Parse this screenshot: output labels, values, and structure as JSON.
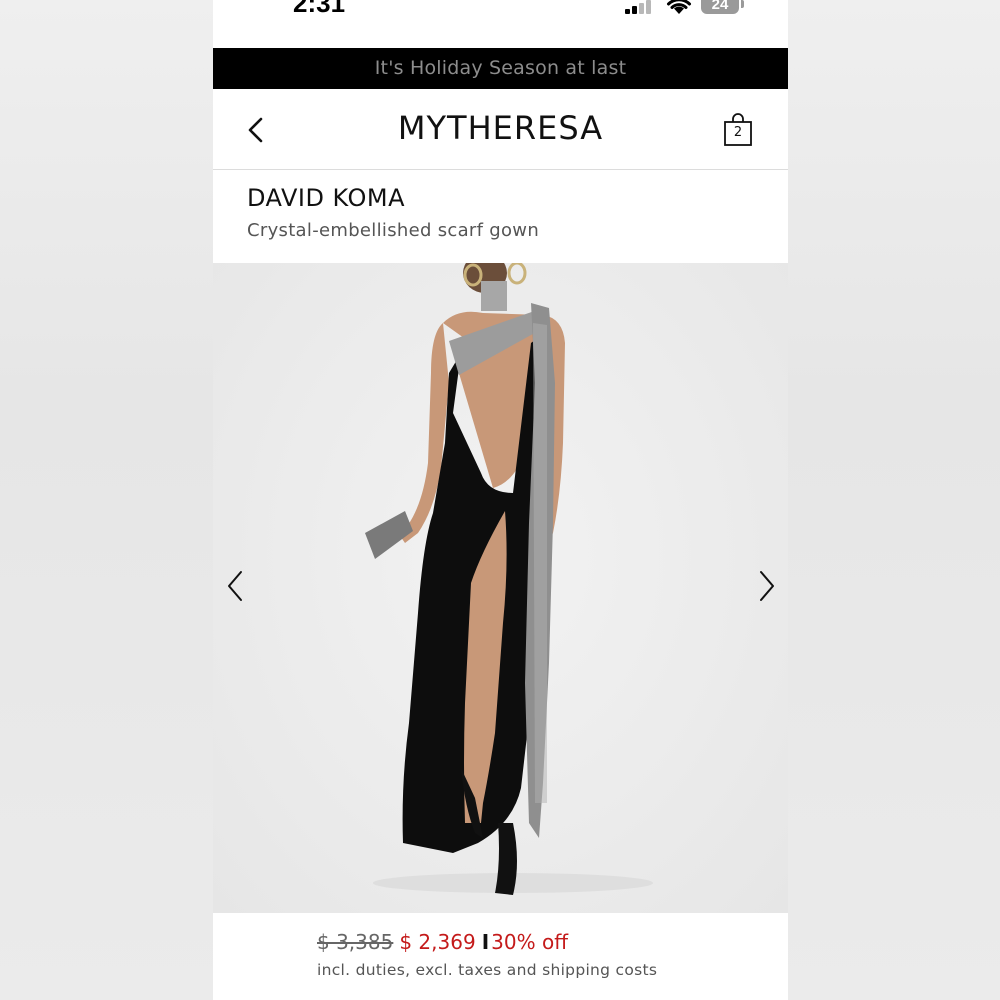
{
  "status_bar": {
    "time": "2:31",
    "battery_level": "24"
  },
  "promo_banner": {
    "text": "It's Holiday Season at last"
  },
  "header": {
    "logo": "MYTHERESA",
    "bag_count": "2",
    "back_icon": "chevron-left-icon",
    "bag_icon": "shopping-bag-icon"
  },
  "product": {
    "brand": "DAVID KOMA",
    "name": "Crystal-embellished scarf gown"
  },
  "gallery": {
    "prev_icon": "chevron-left-icon",
    "next_icon": "chevron-right-icon"
  },
  "price": {
    "original": "$ 3,385",
    "current": "$ 2,369",
    "separator": "I",
    "discount": "30% off",
    "note": "incl. duties, excl. taxes and shipping costs"
  },
  "colors": {
    "sale_red": "#c41a1a",
    "banner_bg": "#000000",
    "banner_text": "#8d8d8d"
  }
}
